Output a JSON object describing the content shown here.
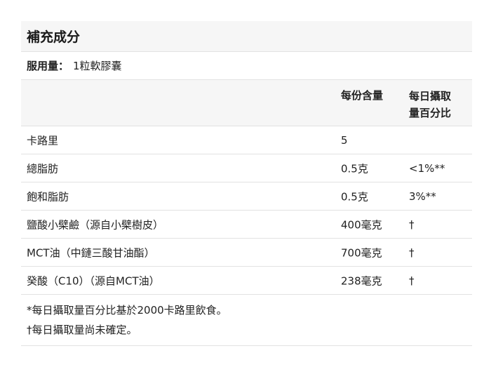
{
  "panel": {
    "title": "補充成分",
    "serving_label": "服用量：",
    "serving_value": "1粒軟膠囊",
    "header": {
      "amount": "每份含量",
      "daily_value_line1": "每日攝取",
      "daily_value_line2": "量百分比"
    },
    "rows": [
      {
        "name": "卡路里",
        "amount": "5",
        "dv": ""
      },
      {
        "name": "總脂肪",
        "amount": "0.5克",
        "dv": "<1%**"
      },
      {
        "name": "飽和脂肪",
        "amount": "0.5克",
        "dv": "3%**"
      },
      {
        "name": "鹽酸小檗鹼（源自小檗樹皮）",
        "amount": "400毫克",
        "dv": "†"
      },
      {
        "name": "MCT油（中鏈三酸甘油酯）",
        "amount": "700毫克",
        "dv": "†"
      },
      {
        "name": "癸酸（C10）（源自MCT油）",
        "amount": "238毫克",
        "dv": "†"
      }
    ],
    "footnotes": [
      "*每日攝取量百分比基於2000卡路里飲食。",
      "†每日攝取量尚未確定。"
    ]
  }
}
